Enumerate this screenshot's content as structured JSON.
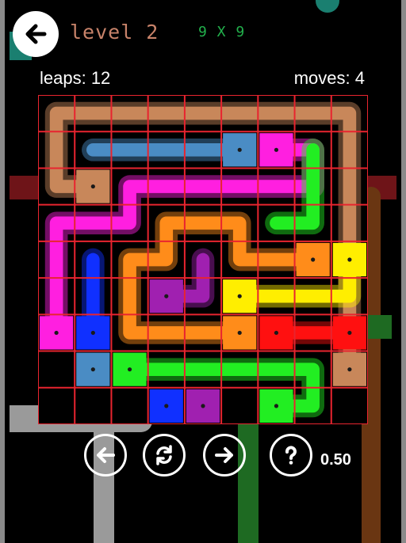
{
  "header": {
    "back_icon": "arrow-left-icon",
    "level": "level 2",
    "size": "9 X 9"
  },
  "stats": {
    "leaps": "leaps: 12",
    "moves": "moves: 4"
  },
  "controls": {
    "undo_icon": "arrow-left-icon",
    "restart_icon": "refresh-icon",
    "redo_icon": "arrow-right-icon",
    "help_icon": "question-icon",
    "timer": "0.50"
  },
  "grid": {
    "rows": 9,
    "cols": 9,
    "line_color": "#e8242f"
  },
  "flows": [
    {
      "name": "tan",
      "color": "#c8875a",
      "endpoints": [
        [
          2,
          1
        ],
        [
          7,
          8
        ]
      ],
      "path": [
        [
          2,
          1
        ],
        [
          2,
          0
        ],
        [
          1,
          0
        ],
        [
          0,
          0
        ],
        [
          0,
          1
        ],
        [
          0,
          2
        ],
        [
          0,
          3
        ],
        [
          0,
          4
        ],
        [
          0,
          5
        ],
        [
          0,
          6
        ],
        [
          0,
          7
        ],
        [
          0,
          8
        ],
        [
          1,
          8
        ],
        [
          2,
          8
        ],
        [
          3,
          8
        ],
        [
          4,
          8
        ],
        [
          5,
          8
        ],
        [
          6,
          8
        ],
        [
          7,
          8
        ]
      ]
    },
    {
      "name": "steel-blue",
      "color": "#4a8cc4",
      "endpoints": [
        [
          1,
          5
        ],
        [
          7,
          1
        ]
      ],
      "path": [
        [
          1,
          5
        ],
        [
          1,
          4
        ],
        [
          1,
          3
        ],
        [
          1,
          2
        ],
        [
          1,
          1
        ]
      ]
    },
    {
      "name": "magenta",
      "color": "#ff1fe0",
      "endpoints": [
        [
          1,
          6
        ],
        [
          6,
          0
        ]
      ],
      "path": [
        [
          1,
          6
        ],
        [
          1,
          7
        ],
        [
          2,
          7
        ],
        [
          2,
          6
        ],
        [
          2,
          5
        ],
        [
          2,
          4
        ],
        [
          2,
          3
        ],
        [
          2,
          2
        ],
        [
          3,
          2
        ],
        [
          3,
          1
        ],
        [
          3,
          0
        ],
        [
          4,
          0
        ],
        [
          5,
          0
        ],
        [
          6,
          0
        ]
      ]
    },
    {
      "name": "green",
      "color": "#22ee22",
      "endpoints": [
        [
          7,
          2
        ],
        [
          8,
          6
        ]
      ],
      "path": [
        [
          1,
          7
        ],
        [
          2,
          7
        ],
        [
          3,
          7
        ],
        [
          3,
          6
        ]
      ]
    },
    {
      "name": "orange",
      "color": "#ff8c1a",
      "endpoints": [
        [
          4,
          7
        ],
        [
          6,
          5
        ]
      ],
      "path": [
        [
          4,
          7
        ],
        [
          4,
          6
        ],
        [
          4,
          5
        ],
        [
          3,
          5
        ],
        [
          3,
          4
        ],
        [
          3,
          3
        ],
        [
          4,
          3
        ],
        [
          4,
          2
        ],
        [
          5,
          2
        ],
        [
          6,
          2
        ],
        [
          6,
          3
        ],
        [
          6,
          4
        ],
        [
          6,
          5
        ]
      ]
    },
    {
      "name": "yellow",
      "color": "#ffee00",
      "endpoints": [
        [
          4,
          8
        ],
        [
          5,
          5
        ]
      ],
      "path": [
        [
          4,
          8
        ],
        [
          5,
          8
        ],
        [
          5,
          7
        ],
        [
          5,
          6
        ],
        [
          5,
          5
        ]
      ]
    },
    {
      "name": "purple",
      "color": "#a020b0",
      "endpoints": [
        [
          5,
          3
        ],
        [
          8,
          4
        ]
      ],
      "path": [
        [
          5,
          3
        ],
        [
          5,
          4
        ],
        [
          4,
          4
        ]
      ]
    },
    {
      "name": "blue",
      "color": "#1030ff",
      "endpoints": [
        [
          6,
          1
        ],
        [
          8,
          3
        ]
      ],
      "path": [
        [
          6,
          1
        ],
        [
          5,
          1
        ],
        [
          4,
          1
        ]
      ]
    },
    {
      "name": "red",
      "color": "#ff1010",
      "endpoints": [
        [
          6,
          6
        ],
        [
          6,
          8
        ]
      ],
      "path": [
        [
          6,
          6
        ],
        [
          6,
          7
        ],
        [
          6,
          8
        ]
      ]
    },
    {
      "name": "green-bottom",
      "color": "#22ee22",
      "endpoints": [
        [
          7,
          2
        ],
        [
          8,
          6
        ]
      ],
      "path": [
        [
          7,
          2
        ],
        [
          7,
          3
        ],
        [
          7,
          4
        ],
        [
          7,
          5
        ],
        [
          7,
          6
        ],
        [
          7,
          7
        ],
        [
          8,
          7
        ],
        [
          8,
          6
        ]
      ]
    },
    {
      "name": "orange-bottom",
      "color": "#ff8c1a",
      "endpoints": [
        [
          8,
          4
        ],
        [
          8,
          4
        ]
      ],
      "path": [
        [
          8,
          4
        ]
      ]
    }
  ]
}
